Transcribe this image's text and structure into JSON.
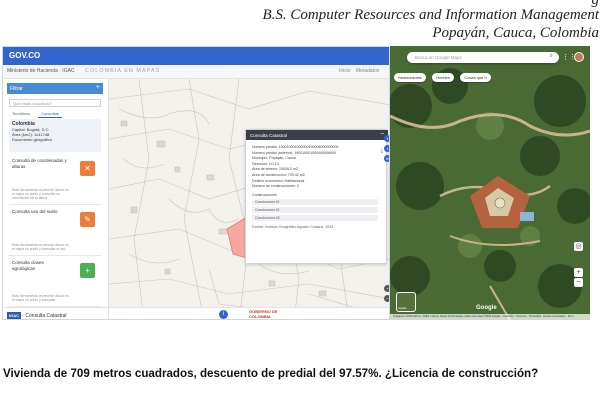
{
  "header": {
    "line1": "g",
    "line2": "B.S. Computer Resources and Information Management",
    "line3": "Popayán, Cauca, Colombia"
  },
  "left_app": {
    "gov_label": "GOV.CO",
    "brand": "Ministerio de Hacienda · IGAC",
    "app_title": "COLOMBIA EN MAPAS",
    "top_links": [
      "Inicio",
      "Metadatos"
    ],
    "sidebar_header": "Filtrar",
    "search_placeholder": "Qué estás buscando?",
    "tabs": [
      "Temáticos",
      "Consultas"
    ],
    "colombia_box": {
      "name": "Colombia",
      "line1": "Capital: Bogotá, D.C.",
      "line2": "Área (km2): 1141748",
      "line3": "Documento geográfico"
    },
    "cards": [
      {
        "title": "Consulta de coordenadas y alturas",
        "desc": "Esta herramienta te permite ubicar en el mapa un punto y consultar su información de la altura",
        "color": "#ee7d3a",
        "icon": "crosshair-icon"
      },
      {
        "title": "Consulta uso del suelo",
        "desc": "Esta herramienta te permite ubicar en el mapa un punto y consultar el uso",
        "color": "#ee7d3a",
        "icon": "pen-icon"
      },
      {
        "title": "Consulta clases agrológicas",
        "desc": "Esta herramienta te permite ubicar en el mapa un punto y consultar",
        "color": "#4caf50",
        "icon": "plus-icon"
      }
    ],
    "footer_logo": "IGAC",
    "footer_text": "Consulta Catastral",
    "gobierno": "GOBIERNO DE COLOMBIA"
  },
  "popup": {
    "title": "Consulta Catastral",
    "lines": [
      "Número predial: 190010001000000490006000000000",
      "Número predial (anterior): 190010001000490006000",
      "Municipio: Popayán, Cauca",
      "Dirección: LO 13",
      "Área de terreno: 15006.2 m2",
      "Área de construcción: 709.42 m2",
      "Destino económico: Habitacional",
      "Número de construcciones: 3"
    ],
    "construcciones_label": "Construcciones",
    "construcciones": [
      "Construcción #1",
      "Construcción #2",
      "Construcción #3"
    ],
    "fuente": "Fuente: Instituto Geográfico Agustín Codazzi, 2023"
  },
  "right_app": {
    "search_placeholder": "Busca en Google Maps",
    "chips": [
      "Restaurantes",
      "Hoteles",
      "Cosas que h"
    ],
    "layers_label": "Capas",
    "google": "Google",
    "attribution": "Imágenes ©2024 Airbus, CNES / Airbus, Maxar Technologies, Datos del mapa ©2024 Google · Colombia · Términos · Privacidad · Enviar comentarios · 20 m"
  },
  "caption": "Vivienda de 709 metros cuadrados, descuento de predial del 97.57%. ¿Licencia de construcción?",
  "colors": {
    "gov_blue": "#3366cc",
    "parcel_highlight": "#f4a8a0",
    "popup_header": "#3a3f47"
  }
}
